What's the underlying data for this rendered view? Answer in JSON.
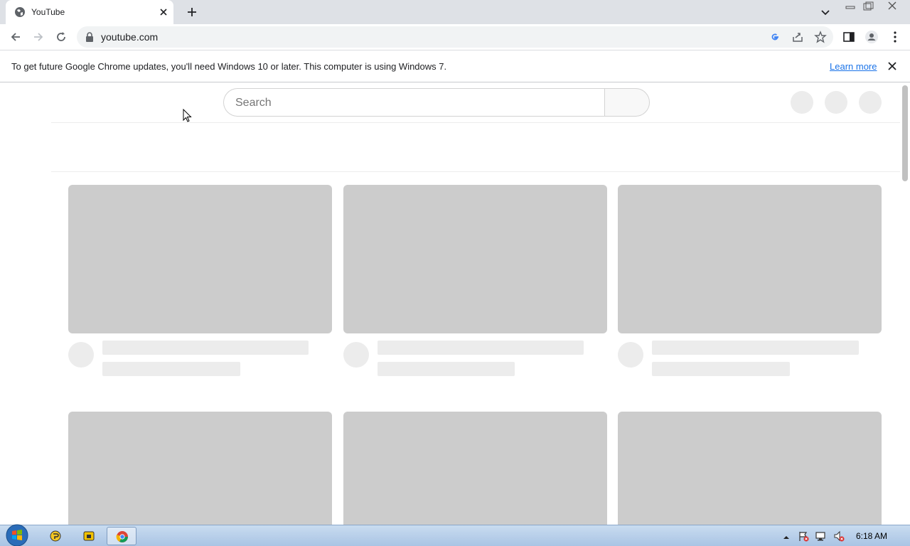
{
  "browser": {
    "tab": {
      "title": "YouTube"
    },
    "address_bar": {
      "url": "youtube.com"
    }
  },
  "infobar": {
    "message": "To get future Google Chrome updates, you'll need Windows 10 or later. This computer is using Windows 7.",
    "link": "Learn more"
  },
  "page": {
    "search": {
      "placeholder": "Search"
    }
  },
  "taskbar": {
    "clock": "6:18 AM"
  },
  "colors": {
    "placeholder_thumbnail": "#cccccc",
    "placeholder_line": "#ececec",
    "link": "#1a73e8"
  }
}
